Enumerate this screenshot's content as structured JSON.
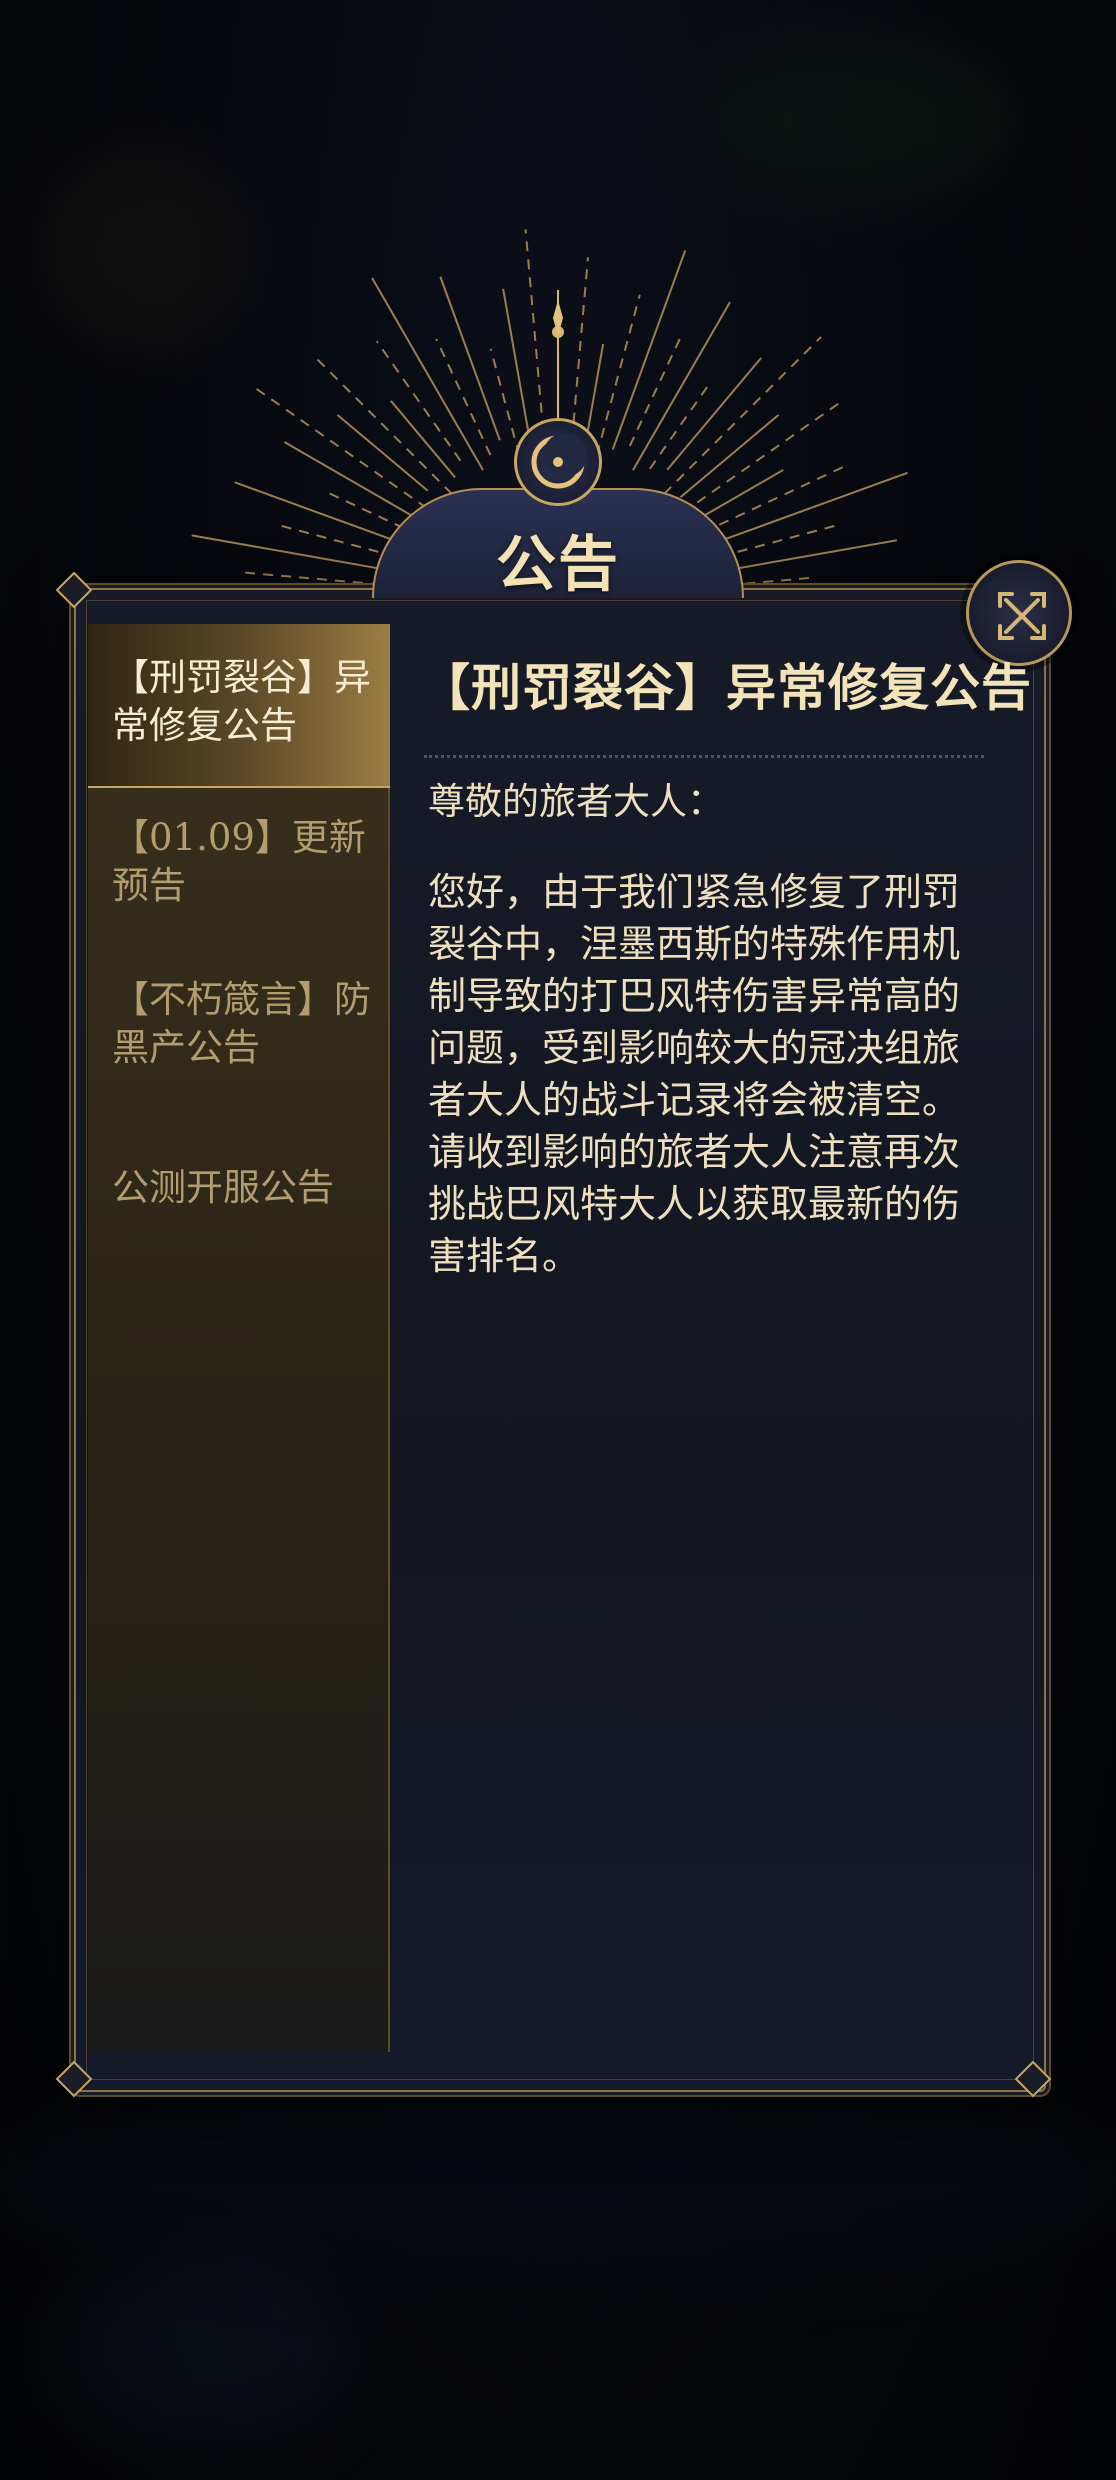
{
  "header": {
    "title": "公告"
  },
  "close_button": {
    "icon": "close-icon"
  },
  "sidebar": {
    "items": [
      {
        "label": "【刑罚裂谷】异常修复公告",
        "active": true
      },
      {
        "label": "【01.09】更新预告",
        "active": false
      },
      {
        "label": "【不朽箴言】防黑产公告",
        "active": false
      },
      {
        "label": "公测开服公告",
        "active": false
      }
    ]
  },
  "content": {
    "title": "【刑罚裂谷】异常修复公告",
    "greeting": "尊敬的旅者大人：",
    "body": "您好，由于我们紧急修复了刑罚裂谷中，涅墨西斯的特殊作用机制导致的打巴风特伤害异常高的问题，受到影响较大的冠决组旅者大人的战斗记录将会被清空。请收到影响的旅者大人注意再次挑战巴风特大人以获取最新的伤害排名。"
  },
  "colors": {
    "gold": "#c9a562",
    "title_text": "#f3e2b6",
    "panel_bg": "#171b28",
    "sidebar_active": "#9c7d43"
  }
}
